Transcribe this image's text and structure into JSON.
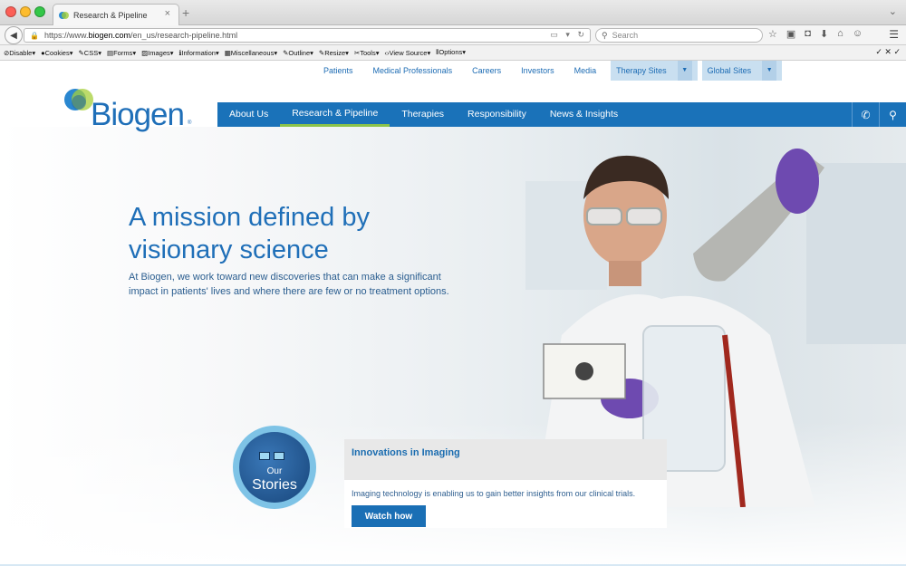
{
  "browser": {
    "tab_title": "Research & Pipeline",
    "tab_close": "×",
    "new_tab": "+",
    "url_prefix": "https://www.",
    "url_domain": "biogen.com",
    "url_path": "/en_us/research-pipeline.html",
    "search_placeholder": "Search"
  },
  "devtoolbar": {
    "items": [
      "Disable",
      "Cookies",
      "CSS",
      "Forms",
      "Images",
      "Information",
      "Miscellaneous",
      "Outline",
      "Resize",
      "Tools",
      "View Source",
      "Options"
    ]
  },
  "site": {
    "logo_text": "Biogen",
    "logo_reg": "®",
    "util_nav": [
      "Patients",
      "Medical Professionals",
      "Careers",
      "Investors",
      "Media"
    ],
    "therapy_sites": "Therapy Sites",
    "global_sites": "Global Sites",
    "main_nav": [
      "About Us",
      "Research & Pipeline",
      "Therapies",
      "Responsibility",
      "News & Insights"
    ],
    "active_nav": "Research & Pipeline"
  },
  "hero": {
    "headline_line1": "A mission defined by",
    "headline_line2": "visionary science",
    "lede": "At Biogen, we work toward new discoveries that can make a significant impact in patients' lives and where there are few or no treatment options."
  },
  "stories": {
    "badge_our": "Our",
    "badge_stories": "Stories",
    "title": "Innovations in Imaging",
    "description": "Imaging technology is enabling us to gain better insights from our clinical trials.",
    "button": "Watch how"
  },
  "colors": {
    "brand_blue": "#1a72b9",
    "nav_active_accent": "#8bc34a",
    "dropdown_bg": "#c9dff0"
  }
}
